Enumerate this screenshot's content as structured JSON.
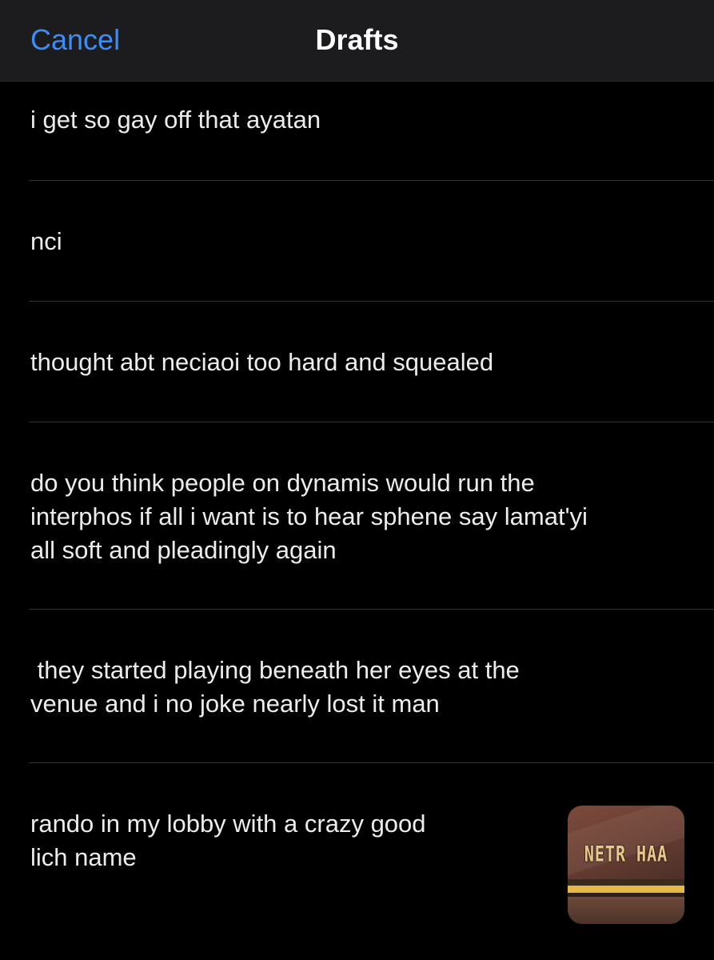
{
  "header": {
    "cancel_label": "Cancel",
    "title": "Drafts"
  },
  "drafts": [
    {
      "lines": [
        "i get so gay off that ayatan"
      ]
    },
    {
      "lines": [
        "nci"
      ]
    },
    {
      "lines": [
        "thought abt neciaoi too hard and squealed"
      ]
    },
    {
      "lines": [
        "do you think people on dynamis would run the",
        "interphos if all i want is to hear sphene say lamatʹyi",
        "all soft and pleadingly again"
      ]
    },
    {
      "lines": [
        " they started playing beneath her eyes at the",
        "venue and i no joke nearly lost it man"
      ]
    },
    {
      "lines": [
        "rando in my lobby with a crazy good",
        "lich name"
      ],
      "thumbnail_text": "NETR HAA"
    }
  ],
  "colors": {
    "accent": "#3a8ef6",
    "navbar_bg": "#1c1c1e",
    "background": "#000000",
    "divider": "#333335",
    "text": "#ececec"
  }
}
